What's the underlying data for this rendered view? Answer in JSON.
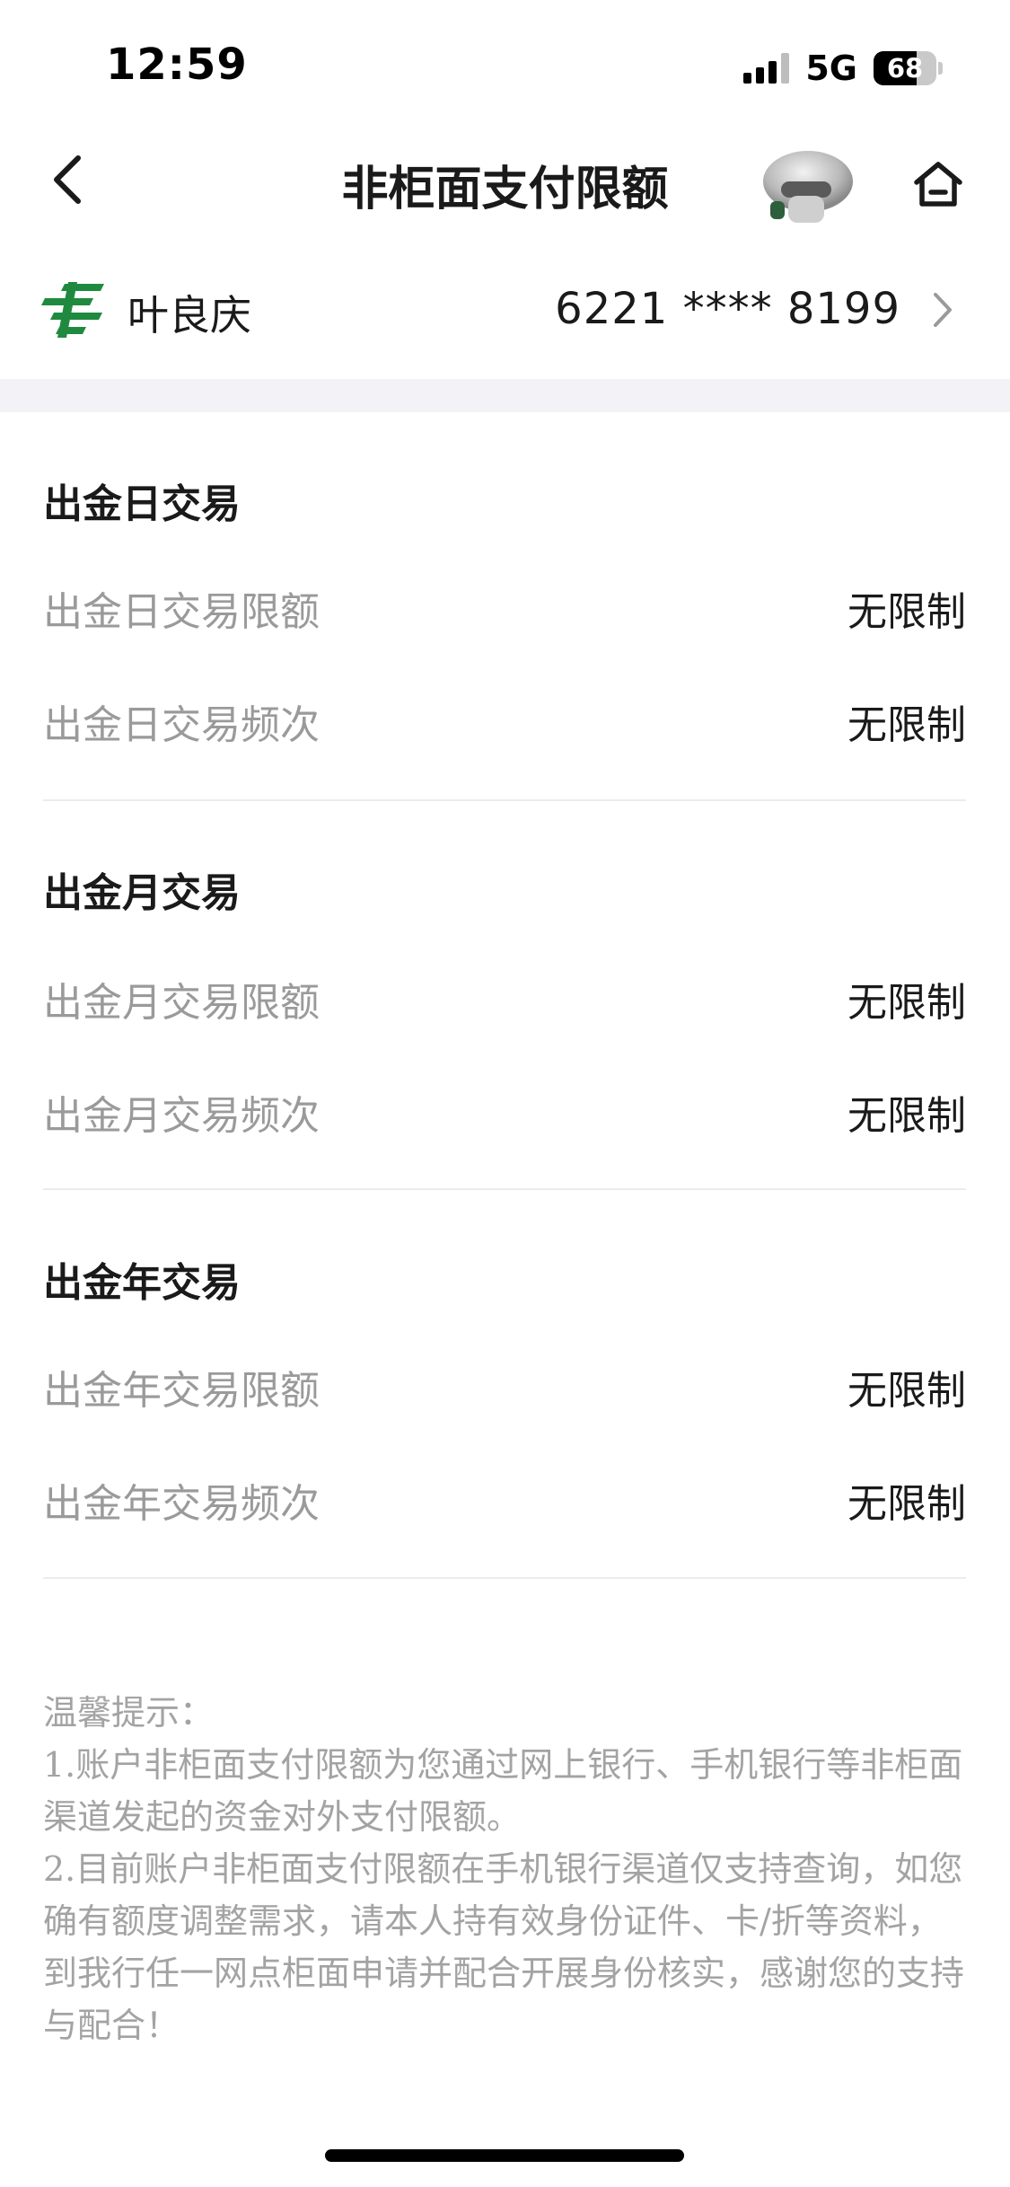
{
  "status_bar": {
    "time": "12:59",
    "network": "5G",
    "battery": "68",
    "battery_level": 0.68
  },
  "nav": {
    "title": "非柜面支付限额",
    "back_icon": "chevron-left-icon",
    "home_icon": "home-icon"
  },
  "account": {
    "name": "叶良庆",
    "number": "6221 **** 8199",
    "logo_color": "#1f8a3f"
  },
  "groups": [
    {
      "title": "出金日交易",
      "rows": [
        {
          "label": "出金日交易限额",
          "value": "无限制"
        },
        {
          "label": "出金日交易频次",
          "value": "无限制"
        }
      ]
    },
    {
      "title": "出金月交易",
      "rows": [
        {
          "label": "出金月交易限额",
          "value": "无限制"
        },
        {
          "label": "出金月交易频次",
          "value": "无限制"
        }
      ]
    },
    {
      "title": "出金年交易",
      "rows": [
        {
          "label": "出金年交易限额",
          "value": "无限制"
        },
        {
          "label": "出金年交易频次",
          "value": "无限制"
        }
      ]
    }
  ],
  "notice": {
    "heading": "温馨提示：",
    "item1": "1.账户非柜面支付限额为您通过网上银行、手机银行等非柜面渠道发起的资金对外支付限额。",
    "item2": "2.目前账户非柜面支付限额在手机银行渠道仅支持查询，如您确有额度调整需求，请本人持有效身份证件、卡/折等资料，到我行任一网点柜面申请并配合开展身份核实，感谢您的支持与配合！"
  }
}
